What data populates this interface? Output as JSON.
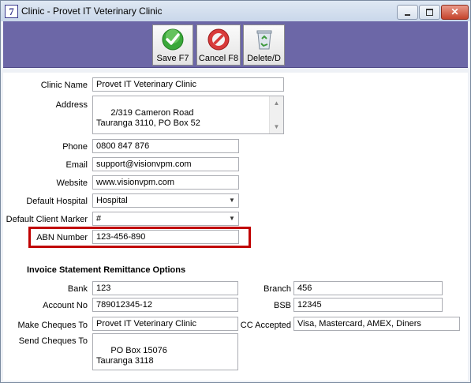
{
  "window": {
    "app_icon": "7",
    "title": "Clinic - Provet IT Veterinary Clinic",
    "min_icon": "minimize-icon",
    "max_icon": "maximize-icon",
    "close_icon": "close-icon"
  },
  "toolbar": {
    "save_label": "Save F7",
    "cancel_label": "Cancel F8",
    "delete_label": "Delete/D",
    "save_icon": "checkmark-icon",
    "cancel_icon": "prohibited-icon",
    "delete_icon": "recycle-bin-icon",
    "background_color": "#6c67a7"
  },
  "clinic": {
    "name_label": "Clinic Name",
    "name_value": "Provet IT Veterinary Clinic",
    "address_label": "Address",
    "address_value": "2/319 Cameron Road\nTauranga 3110, PO Box 52",
    "phone_label": "Phone",
    "phone_value": "0800 847 876",
    "email_label": "Email",
    "email_value": "support@visionvpm.com",
    "website_label": "Website",
    "website_value": "www.visionvpm.com",
    "hospital_label": "Default Hospital",
    "hospital_value": "Hospital",
    "marker_label": "Default Client Marker",
    "marker_value": "#",
    "abn_label": "ABN Number",
    "abn_value": "123-456-890",
    "highlight_color": "#c00000"
  },
  "invoice": {
    "section_title": "Invoice Statement Remittance Options",
    "bank_label": "Bank",
    "bank_value": "123",
    "branch_label": "Branch",
    "branch_value": "456",
    "account_label": "Account No",
    "account_value": "789012345-12",
    "bsb_label": "BSB",
    "bsb_value": "12345",
    "make_cheques_label": "Make Cheques To",
    "make_cheques_value": "Provet IT Veterinary Clinic",
    "cc_label": "CC Accepted",
    "cc_value": "Visa, Mastercard, AMEX, Diners",
    "send_cheques_label": "Send Cheques To",
    "send_cheques_value": "PO Box 15076\nTauranga 3118"
  }
}
